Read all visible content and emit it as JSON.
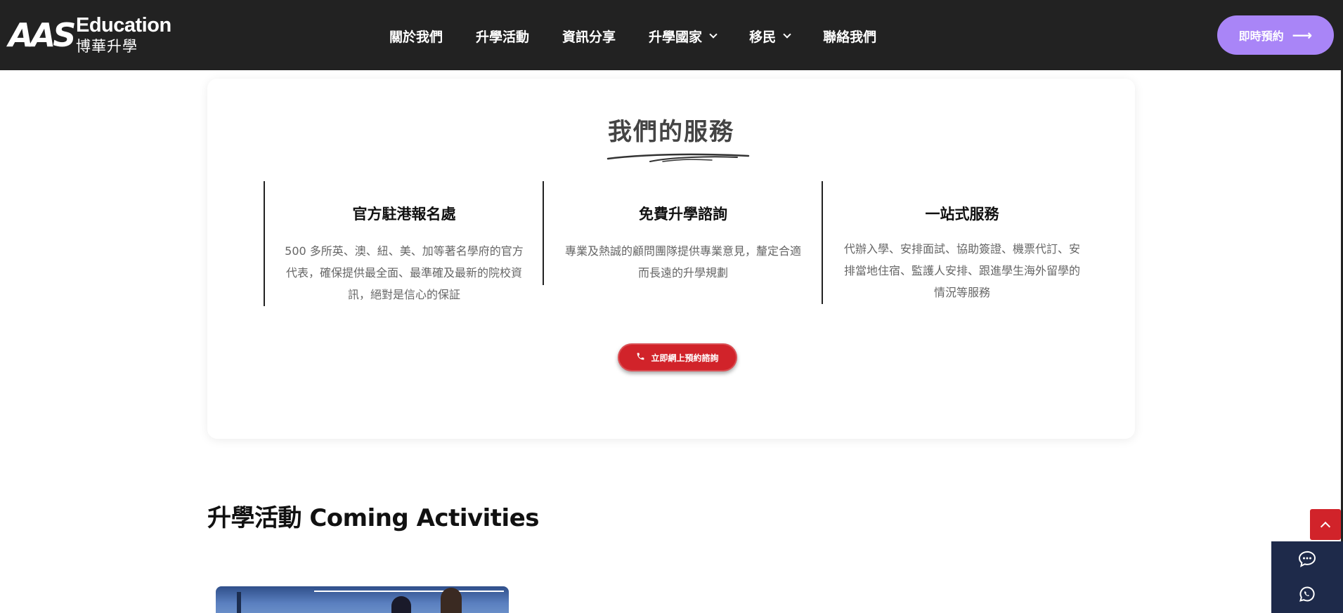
{
  "header": {
    "logo": {
      "mark": "AAS",
      "brand": "Education",
      "brand_zh": "博華升學"
    },
    "nav": [
      {
        "label": "關於我們",
        "has_dropdown": false
      },
      {
        "label": "升學活動",
        "has_dropdown": false
      },
      {
        "label": "資訊分享",
        "has_dropdown": false
      },
      {
        "label": "升學國家",
        "has_dropdown": true
      },
      {
        "label": "移民",
        "has_dropdown": true
      },
      {
        "label": "聯絡我們",
        "has_dropdown": false
      }
    ],
    "cta": {
      "label": "即時預約",
      "icon": "arrow-right-icon"
    }
  },
  "services": {
    "title": "我們的服務",
    "columns": [
      {
        "title": "官方駐港報名處",
        "text_lines": [
          "500 多所英、澳、紐、美、加等著名學府的官方",
          "代表，確保提供最全面、最準確及最新的院校資",
          "訊，絕對是信心的保証"
        ]
      },
      {
        "title": "免費升學諮詢",
        "text_lines": [
          "專業及熱誠的顧問團隊提供專業意見，釐定合適",
          "而長遠的升學規劃"
        ]
      },
      {
        "title": "一站式服務",
        "text_lines": [
          "代辦入學、安排面試、協助簽證、機票代訂、安",
          "排當地住宿、監護人安排、跟進學生海外留學的",
          "情況等服務"
        ]
      }
    ],
    "button": {
      "label": "立即網上預約諮詢",
      "icon": "phone-icon"
    }
  },
  "activities": {
    "heading": "升學活動 Coming Activities"
  },
  "widgets": {
    "scroll_top_icon": "chevron-up-icon",
    "chat_icon": "chat-bubble-icon",
    "whatsapp_icon": "whatsapp-icon"
  },
  "colors": {
    "header_bg": "#222222",
    "accent_purple": "#a985f7",
    "accent_red": "#d1232a",
    "panel_navy": "#1e2a4a"
  }
}
